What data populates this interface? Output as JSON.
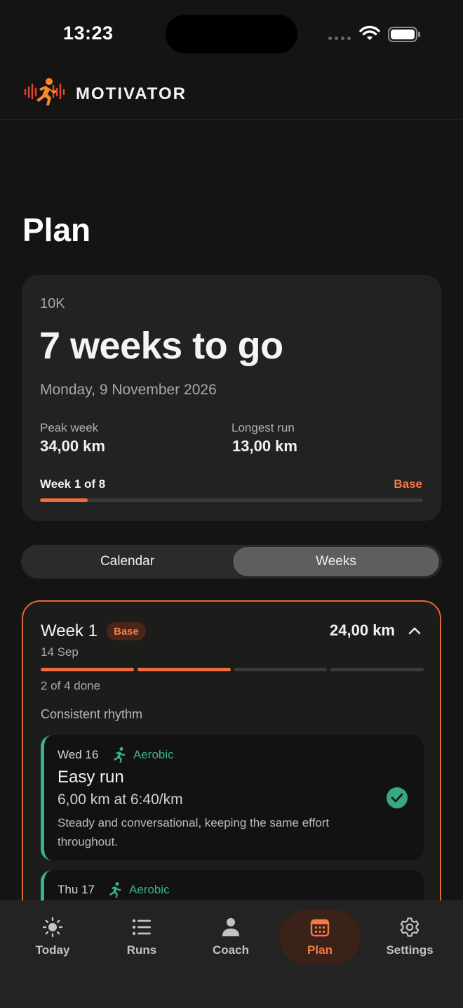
{
  "status_bar": {
    "time": "13:23"
  },
  "header": {
    "app_name": "MOTIVATOR",
    "logo_icon": "runner-waveform-logo"
  },
  "page": {
    "title": "Plan"
  },
  "goal": {
    "race": "10K",
    "headline": "7 weeks to go",
    "race_date": "Monday, 9 November 2026",
    "stats": [
      {
        "label": "Peak week",
        "value": "34,00 km"
      },
      {
        "label": "Longest run",
        "value": "13,00 km"
      }
    ],
    "progress_label": "Week 1 of 8",
    "phase": "Base",
    "progress_fraction": 0.125
  },
  "view_toggle": {
    "options": [
      "Calendar",
      "Weeks"
    ],
    "selected": "Weeks"
  },
  "week": {
    "title": "Week 1",
    "phase_badge": "Base",
    "start": "14 Sep",
    "distance": "24,00 km",
    "completed": 2,
    "total": 4,
    "done_text": "2 of 4 done",
    "focus": "Consistent rhythm",
    "workouts": [
      {
        "day": "Wed 16",
        "type": "Aerobic",
        "title": "Easy run",
        "detail": "6,00 km at 6:40/km",
        "description": "Steady and conversational, keeping the same effort throughout.",
        "completed": true
      },
      {
        "day": "Thu 17",
        "type": "Aerobic"
      }
    ]
  },
  "colors": {
    "accent": "#f26b3a",
    "aerobic": "#3bb28a",
    "background": "#141414",
    "card": "#222221"
  },
  "nav": {
    "items": [
      {
        "label": "Today",
        "icon": "sun-icon"
      },
      {
        "label": "Runs",
        "icon": "list-icon"
      },
      {
        "label": "Coach",
        "icon": "person-icon"
      },
      {
        "label": "Plan",
        "icon": "calendar-icon"
      },
      {
        "label": "Settings",
        "icon": "gear-icon"
      }
    ],
    "active": "Plan"
  }
}
